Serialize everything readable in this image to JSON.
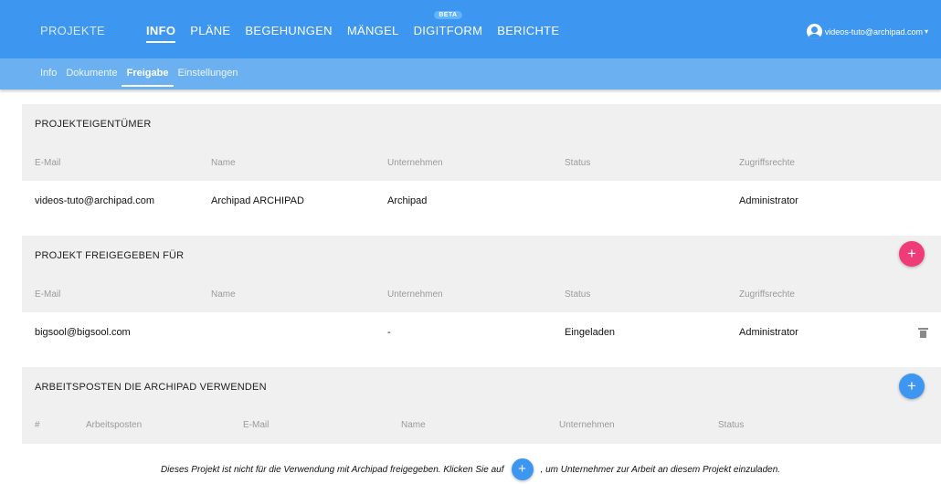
{
  "header": {
    "brand": "PROJEKTE",
    "nav": [
      {
        "label": "INFO",
        "active": true
      },
      {
        "label": "PLÄNE"
      },
      {
        "label": "BEGEHUNGEN"
      },
      {
        "label": "MÄNGEL"
      },
      {
        "label": "DIGITFORM",
        "badge": "BETA"
      },
      {
        "label": "BERICHTE"
      }
    ],
    "account_email": "videos-tuto@archipad.com",
    "caret": "▾"
  },
  "subnav": [
    {
      "label": "Info"
    },
    {
      "label": "Dokumente"
    },
    {
      "label": "Freigabe",
      "active": true
    },
    {
      "label": "Einstellungen"
    }
  ],
  "owners": {
    "title": "PROJEKTEIGENTÜMER",
    "columns": [
      "E-Mail",
      "Name",
      "Unternehmen",
      "Status",
      "Zugriffsrechte"
    ],
    "row": {
      "email": "videos-tuto@archipad.com",
      "name": "Archipad ARCHIPAD",
      "company": "Archipad",
      "status": "",
      "rights": "Administrator"
    }
  },
  "shared": {
    "title": "PROJEKT FREIGEGEBEN FÜR",
    "add_symbol": "+",
    "columns": [
      "E-Mail",
      "Name",
      "Unternehmen",
      "Status",
      "Zugriffsrechte"
    ],
    "row": {
      "email": "bigsool@bigsool.com",
      "name": "",
      "company": "-",
      "status": "Eingeladen",
      "rights": "Administrator"
    }
  },
  "workstations": {
    "title": "ARBEITSPOSTEN DIE ARCHIPAD VERWENDEN",
    "add_symbol": "+",
    "columns": [
      "#",
      "Arbeitsposten",
      "E-Mail",
      "Name",
      "Unternehmen",
      "Status"
    ],
    "notice_before": "Dieses Projekt ist nicht für die Verwendung mit Archipad freigegeben. Klicken Sie auf",
    "notice_after": ", um Unternehmer zur Arbeit an diesem Projekt einzuladen."
  },
  "colors": {
    "header_bg": "#3d97f0",
    "subnav_bg": "#6bb1f2",
    "add_pink": "#ef3b77",
    "add_blue": "#3d97f0",
    "section_bg": "#f0f0f0"
  }
}
